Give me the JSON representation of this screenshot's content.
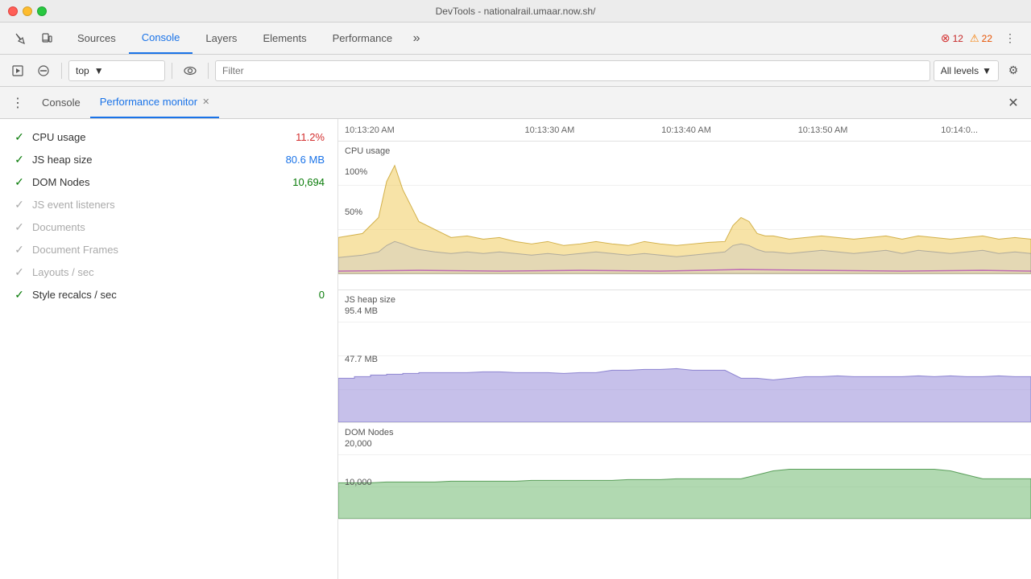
{
  "titleBar": {
    "title": "DevTools - nationalrail.umaar.now.sh/"
  },
  "navBar": {
    "tabs": [
      {
        "label": "Sources",
        "active": false
      },
      {
        "label": "Console",
        "active": true
      },
      {
        "label": "Layers",
        "active": false
      },
      {
        "label": "Elements",
        "active": false
      },
      {
        "label": "Performance",
        "active": false
      }
    ],
    "moreIcon": "»",
    "errors": {
      "icon": "✕",
      "count": "12"
    },
    "warnings": {
      "icon": "⚠",
      "count": "22"
    }
  },
  "consoleToolbar": {
    "clearIcon": "🚫",
    "frameIcon": "▶",
    "contextLabel": "top",
    "filterPlaceholder": "Filter",
    "levelLabel": "All levels",
    "settingsIcon": "⚙"
  },
  "tabBar": {
    "tabs": [
      {
        "label": "Console",
        "active": false,
        "closeable": false
      },
      {
        "label": "Performance monitor",
        "active": true,
        "closeable": true
      }
    ],
    "closeIcon": "✕"
  },
  "metrics": [
    {
      "id": "cpu-usage",
      "active": true,
      "name": "CPU usage",
      "value": "11.2%",
      "valueClass": "val-red"
    },
    {
      "id": "js-heap",
      "active": true,
      "name": "JS heap size",
      "value": "80.6 MB",
      "valueClass": "val-blue"
    },
    {
      "id": "dom-nodes",
      "active": true,
      "name": "DOM Nodes",
      "value": "10,694",
      "valueClass": "val-green"
    },
    {
      "id": "js-events",
      "active": false,
      "name": "JS event listeners",
      "value": "",
      "valueClass": ""
    },
    {
      "id": "documents",
      "active": false,
      "name": "Documents",
      "value": "",
      "valueClass": ""
    },
    {
      "id": "doc-frames",
      "active": false,
      "name": "Document Frames",
      "value": "",
      "valueClass": ""
    },
    {
      "id": "layouts",
      "active": false,
      "name": "Layouts / sec",
      "value": "",
      "valueClass": ""
    },
    {
      "id": "style-recalcs",
      "active": true,
      "name": "Style recalcs / sec",
      "value": "0",
      "valueClass": "val-green"
    }
  ],
  "timeAxis": {
    "labels": [
      "10:13:20 AM",
      "10:13:30 AM",
      "10:13:40 AM",
      "10:13:50 AM",
      "10:14:0..."
    ]
  },
  "cpuChart": {
    "label": "CPU usage",
    "pct100": "100%",
    "pct50": "50%"
  },
  "heapChart": {
    "label": "JS heap size",
    "max": "95.4 MB",
    "mid": "47.7 MB"
  },
  "domChart": {
    "label": "DOM Nodes",
    "max": "20,000",
    "mid": "10,000"
  }
}
